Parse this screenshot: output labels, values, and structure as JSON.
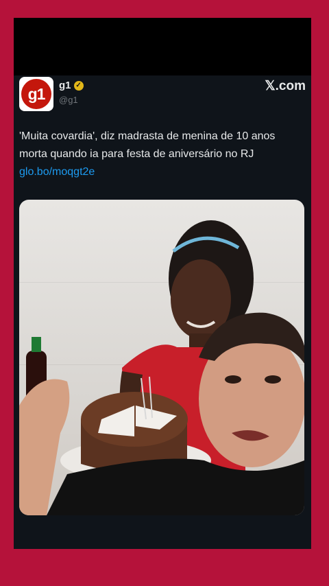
{
  "tweet": {
    "account_name": "g1",
    "handle": "@g1",
    "logo_text": "g1",
    "site": "𝕏.com",
    "text": "'Muita covardia', diz madrasta de menina de 10 anos morta quando ia para festa de aniversário no RJ ",
    "link": "glo.bo/moqgt2e"
  },
  "colors": {
    "outer_frame": "#b5123a",
    "tweet_bg": "#0f141a",
    "link": "#1d9bf0",
    "g1_red": "#c4170c"
  },
  "icons": [
    "verified-badge-icon",
    "x-logo-icon"
  ]
}
